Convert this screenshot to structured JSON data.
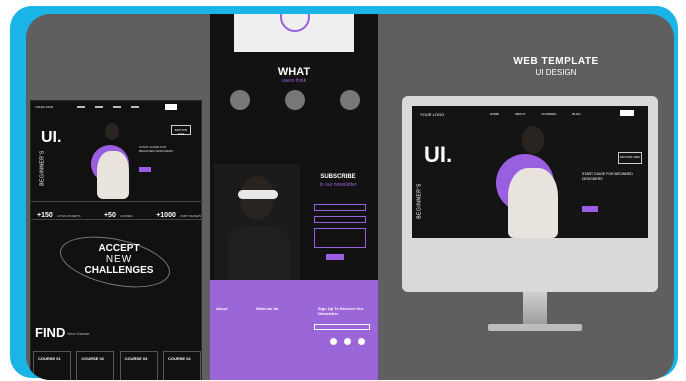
{
  "heading": {
    "line1": "WEB TEMPLATE",
    "line2": "UI DESIGN"
  },
  "left": {
    "logo": "YOUR LOGO",
    "hero_title": "UI.",
    "side_text": "BEGINNER'S",
    "badge": "EDITION 2022",
    "stats": [
      {
        "num": "+150",
        "label": "ACTIVE STUDENTS"
      },
      {
        "num": "+50",
        "label": "COURSES"
      },
      {
        "num": "+1000",
        "label": "HAPPY REVIEWS"
      }
    ],
    "accept": [
      "ACCEPT",
      "NEW",
      "CHALLENGES"
    ],
    "find_title": "FIND",
    "find_sub": "Your Course.",
    "courses": [
      "COURSE 01",
      "COURSE 02",
      "COURSE 03",
      "COURSE 04"
    ]
  },
  "middle": {
    "what_title": "WHAT",
    "what_sub": "users think",
    "subscribe_title": "SUBSCRIBE",
    "subscribe_sub": "to our newsletter",
    "footer": {
      "col1": "About",
      "col2": "What we do",
      "col3": "Sign Up To Receive Our Newsletter"
    }
  },
  "monitor": {
    "logo": "YOUR LOGO",
    "nav": [
      "HOME",
      "ABOUT",
      "COURSES",
      "BLOG"
    ],
    "hero_title": "UI.",
    "side_text": "BEGINNER'S",
    "edition": "EDITION 2022",
    "guide": "START GUIDE FOR BEGINNED DESIGNERS"
  }
}
